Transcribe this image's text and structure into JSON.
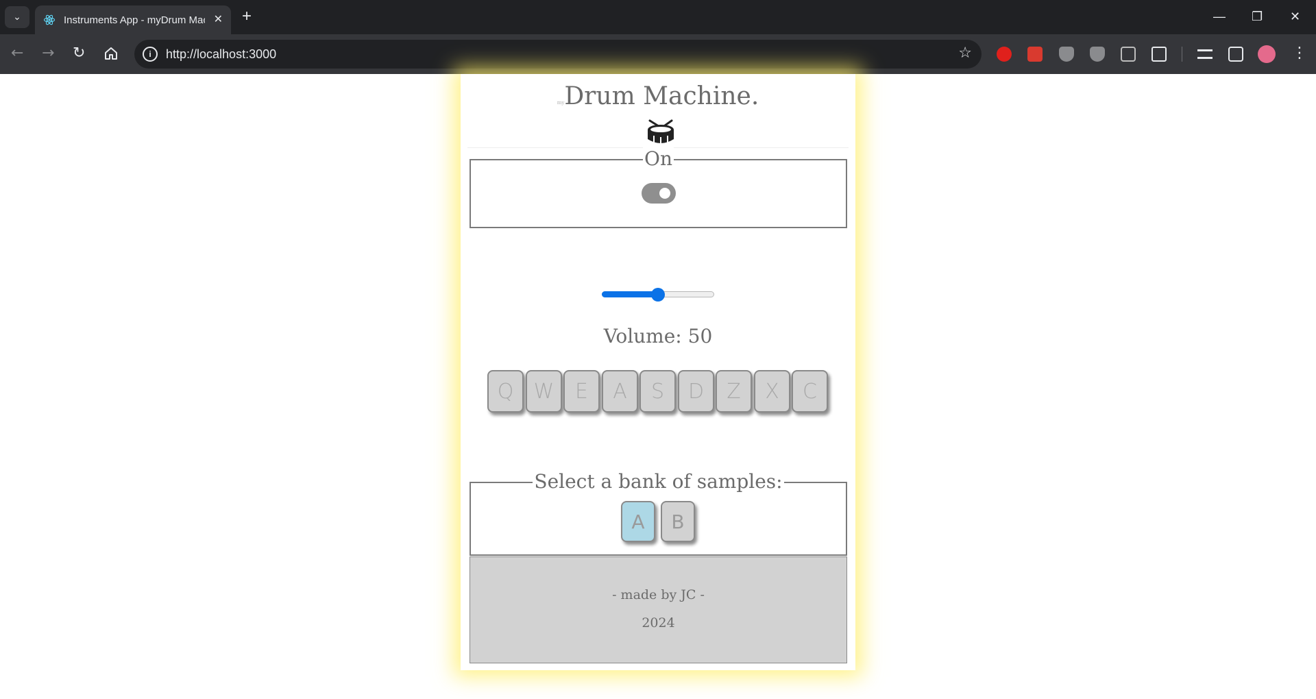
{
  "browser": {
    "tab_title": "Instruments App - myDrum Machine",
    "url": "http://localhost:3000"
  },
  "app": {
    "title_small": "my",
    "title": "Drum Machine.",
    "power": {
      "legend": "On",
      "is_on": true
    },
    "volume": {
      "label": "Volume:",
      "value": 50,
      "min": 0,
      "max": 100
    },
    "pads": [
      "Q",
      "W",
      "E",
      "A",
      "S",
      "D",
      "Z",
      "X",
      "C"
    ],
    "bank": {
      "legend": "Select a bank of samples:",
      "options": [
        "A",
        "B"
      ],
      "selected": "A",
      "selected_color": "#add8e6",
      "unselected_color": "#d2d2d2"
    },
    "footer": {
      "credit": "- made by JC -",
      "year": "2024"
    }
  }
}
